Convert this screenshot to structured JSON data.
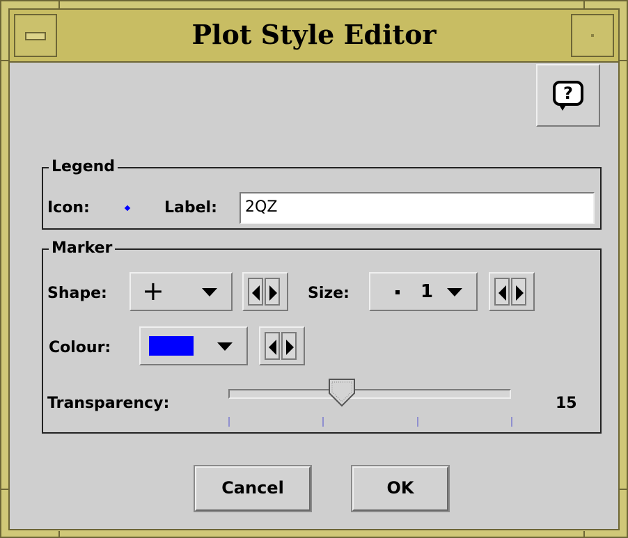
{
  "window": {
    "title": "Plot Style Editor"
  },
  "legend": {
    "group_title": "Legend",
    "icon_label": "Icon:",
    "label_label": "Label:",
    "label_value": "2QZ"
  },
  "marker": {
    "group_title": "Marker",
    "shape_label": "Shape:",
    "shape_value": "+",
    "size_label": "Size:",
    "size_value": "1",
    "colour_label": "Colour:",
    "colour_value": "#0000ff",
    "transparency_label": "Transparency:",
    "transparency_value": "15",
    "transparency_fraction": 0.39
  },
  "buttons": {
    "cancel": "Cancel",
    "ok": "OK"
  },
  "icons": [
    "window-menu-icon",
    "window-minimize-icon",
    "help-icon",
    "chevron-down-icon",
    "arrow-left-icon",
    "arrow-right-icon",
    "slider-thumb-icon"
  ]
}
